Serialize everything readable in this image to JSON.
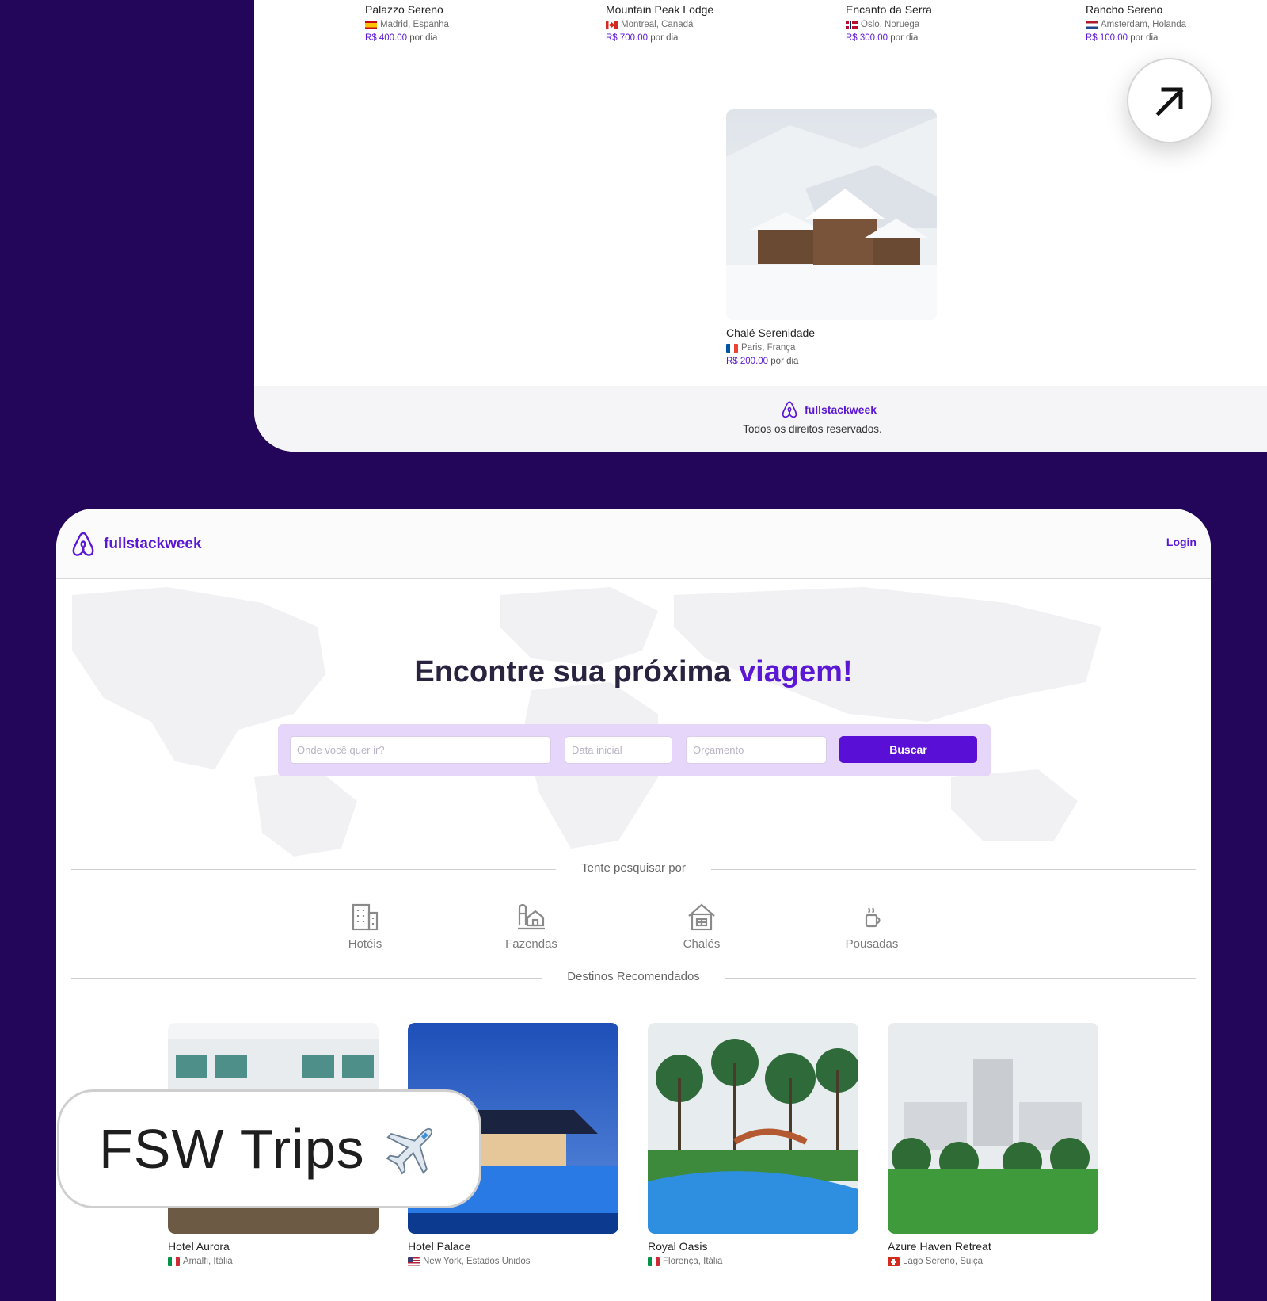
{
  "top_section": {
    "stays": [
      {
        "name": "Palazzo Sereno",
        "location": "Madrid, Espanha",
        "flag": "es",
        "price": "R$ 400.00",
        "unit": "por dia"
      },
      {
        "name": "Mountain Peak Lodge",
        "location": "Montreal, Canadá",
        "flag": "ca",
        "price": "R$ 700.00",
        "unit": "por dia"
      },
      {
        "name": "Encanto da Serra",
        "location": "Oslo, Noruega",
        "flag": "no",
        "price": "R$ 300.00",
        "unit": "por dia"
      },
      {
        "name": "Rancho Sereno",
        "location": "Amsterdam, Holanda",
        "flag": "nl",
        "price": "R$ 100.00",
        "unit": "por dia"
      },
      {
        "name": "Chalé Serenidade",
        "location": "Paris, França",
        "flag": "fr",
        "price": "R$ 200.00",
        "unit": "por dia"
      }
    ],
    "footer": {
      "brand": "fullstackweek",
      "rights": "Todos os direitos reservados."
    }
  },
  "header": {
    "brand": "fullstackweek",
    "login": "Login"
  },
  "hero": {
    "title_main": "Encontre sua próxima ",
    "title_accent": "viagem!"
  },
  "search": {
    "destination_placeholder": "Onde você quer ir?",
    "date_placeholder": "Data inicial",
    "budget_placeholder": "Orçamento",
    "button": "Buscar"
  },
  "suggestions": {
    "heading": "Tente pesquisar por",
    "categories": [
      {
        "label": "Hotéis",
        "icon": "hotel-icon"
      },
      {
        "label": "Fazendas",
        "icon": "farm-icon"
      },
      {
        "label": "Chalés",
        "icon": "chalet-icon"
      },
      {
        "label": "Pousadas",
        "icon": "inn-icon"
      }
    ]
  },
  "recommended": {
    "heading": "Destinos Recomendados",
    "items": [
      {
        "name": "Hotel Aurora",
        "location": "Amalfi, Itália",
        "flag": "it"
      },
      {
        "name": "Hotel Palace",
        "location": "New York, Estados Unidos",
        "flag": "us"
      },
      {
        "name": "Royal Oasis",
        "location": "Florença, Itália",
        "flag": "it"
      },
      {
        "name": "Azure Haven Retreat",
        "location": "Lago Sereno, Suiça",
        "flag": "ch"
      }
    ]
  },
  "badge": {
    "text": "FSW Trips",
    "icon": "airplane-icon"
  },
  "colors": {
    "background": "#23055a",
    "accent": "#5a18d4",
    "search_box": "#e6d6f9"
  }
}
